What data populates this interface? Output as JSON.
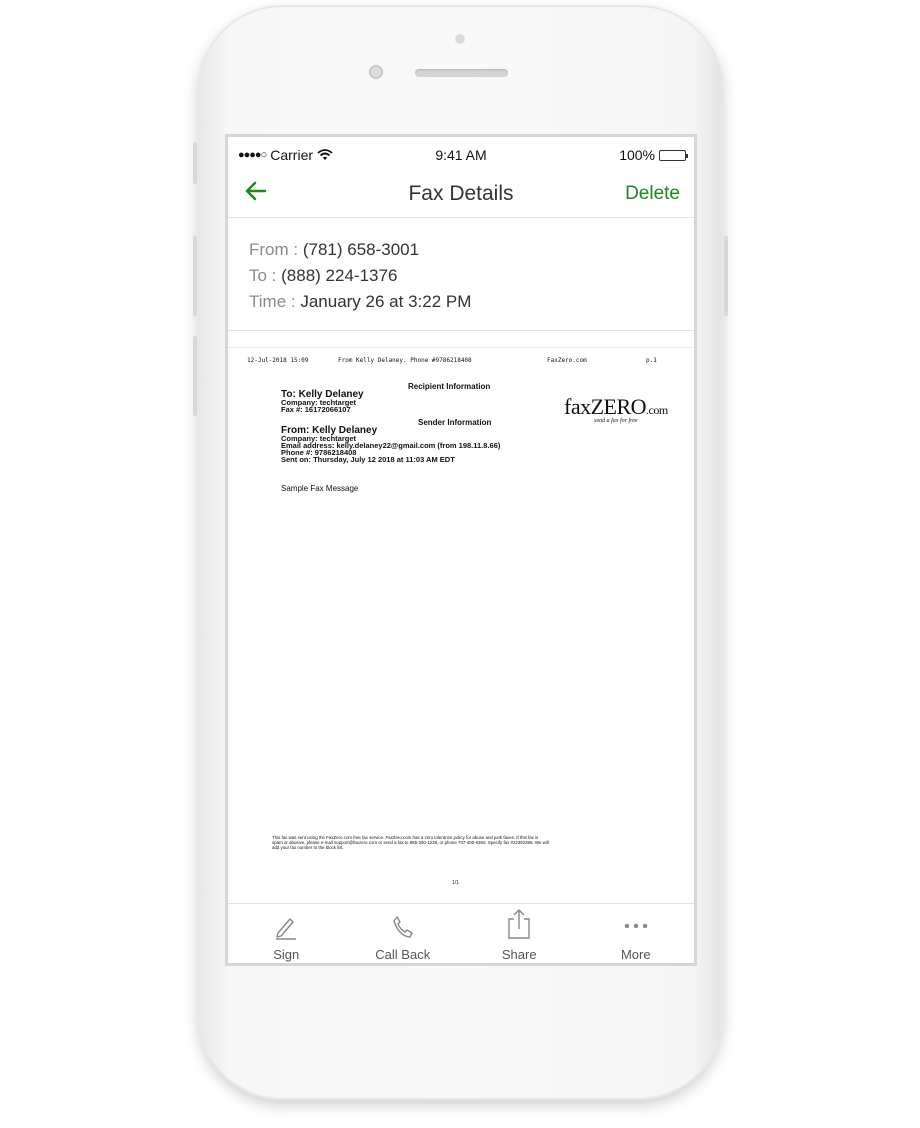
{
  "status_bar": {
    "carrier": "Carrier",
    "time": "9:41 AM",
    "battery": "100%"
  },
  "nav": {
    "title": "Fax Details",
    "delete_label": "Delete"
  },
  "details": {
    "from_label": "From :",
    "from_value": "(781) 658-3001",
    "to_label": "To :",
    "to_value": "(888) 224-1376",
    "time_label": "Time :",
    "time_value": "January 26 at 3:22 PM"
  },
  "fax_page": {
    "header_date": "12-Jul-2018 15:09",
    "header_from": "From Kelly Delaney. Phone #9786218408",
    "header_site": "FaxZero.com",
    "header_page": "p.1",
    "recipient_heading": "Recipient Information",
    "to_line": "To:  Kelly Delaney",
    "to_company": "Company: techtarget",
    "to_fax": "Fax #: 16172066107",
    "sender_heading": "Sender Information",
    "from_line": "From: Kelly Delaney",
    "from_company": "Company: techtarget",
    "from_email": "Email address: kelly.delaney22@gmail.com (from 198.11.8.66)",
    "from_phone": "Phone #: 9786218408",
    "sent_on": "Sent on: Thursday, July 12 2018 at 11:03 AM EDT",
    "message": "Sample Fax Message",
    "logo_main": "faxZERO",
    "logo_domain": ".com",
    "logo_tagline": "send a fax for free",
    "footer_line1": "This fax was sent using the FaxZero.com free fax service. FaxZero.com has a zero tolerance policy for abuse and junk faxes. If this fax is",
    "footer_line2": "spam or abusive, please e-mail support@faxzero.com or send a fax to 855-330-1238, or phone 707-400-6360. Specify fax #22392365. We will",
    "footer_line3": "add your fax number to the block list.",
    "page_number": "1/1"
  },
  "tab_bar": {
    "items": [
      {
        "label": "Sign",
        "icon": "pencil-icon"
      },
      {
        "label": "Call Back",
        "icon": "phone-icon"
      },
      {
        "label": "Share",
        "icon": "share-icon"
      },
      {
        "label": "More",
        "icon": "ellipsis-icon"
      }
    ]
  },
  "colors": {
    "accent": "#1a8a1a",
    "battery": "#4cd964"
  }
}
